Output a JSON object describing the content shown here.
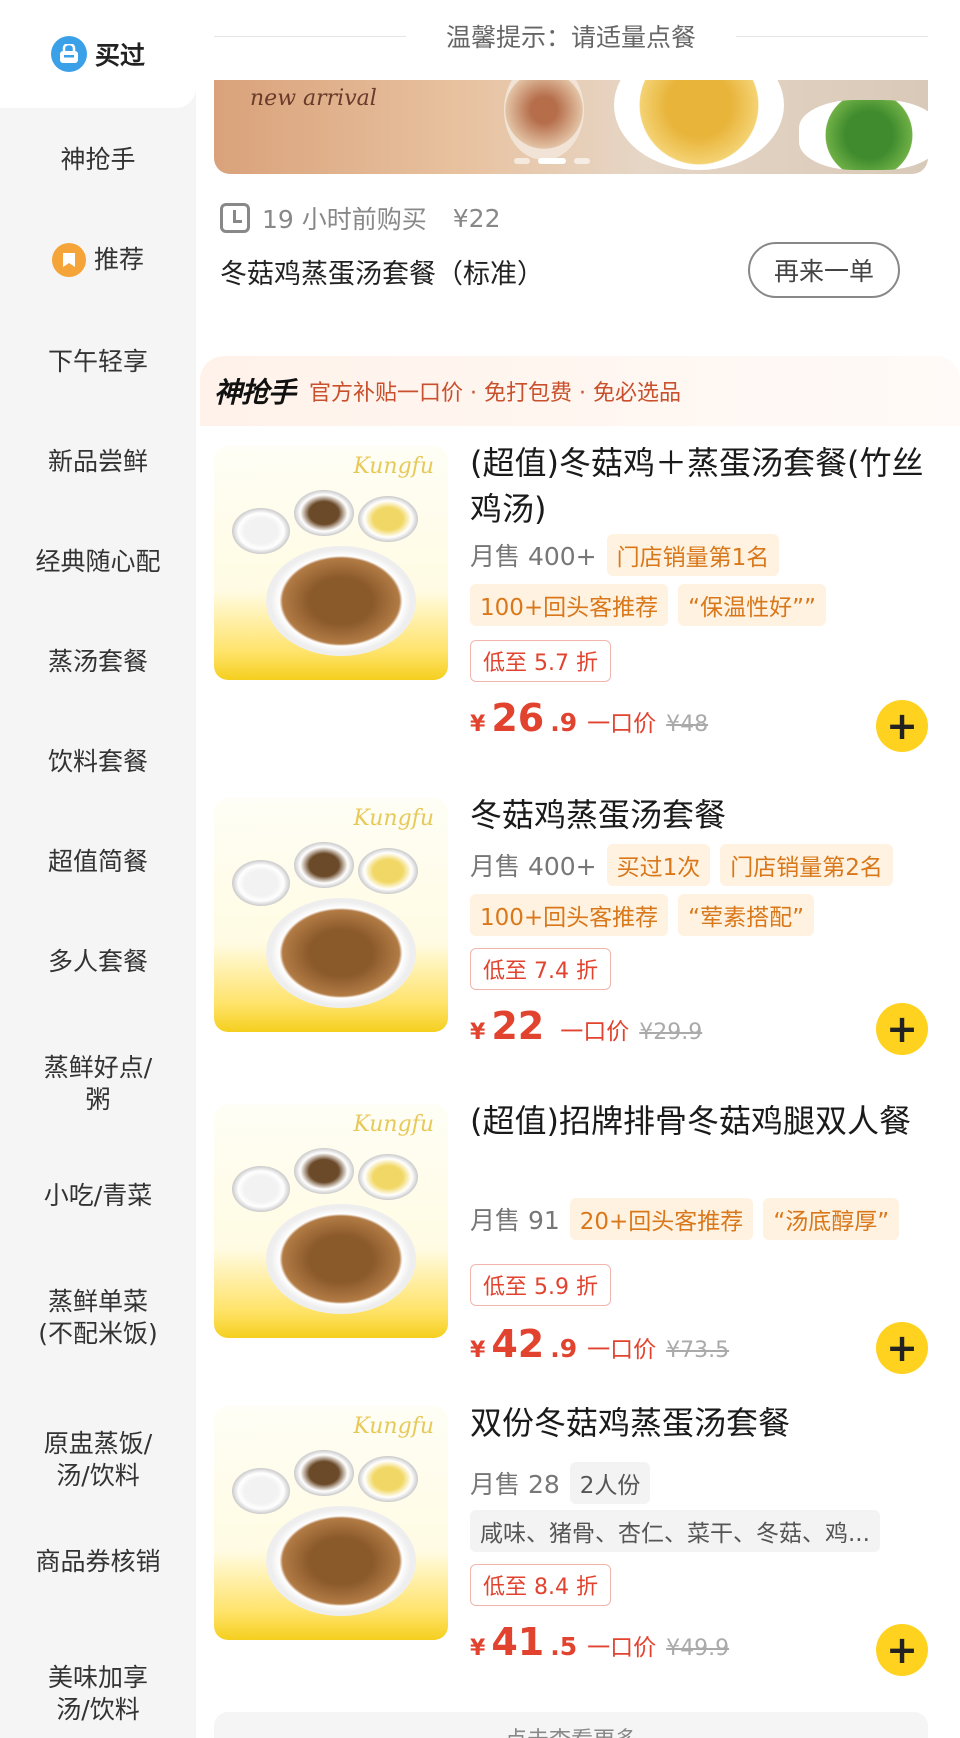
{
  "sidebar": {
    "top_label": "买过",
    "items": [
      {
        "label": "神抢手"
      },
      {
        "label": "推荐"
      },
      {
        "label": "下午轻享"
      },
      {
        "label": "新品尝鲜"
      },
      {
        "label": "经典随心配"
      },
      {
        "label": "蒸汤套餐"
      },
      {
        "label": "饮料套餐"
      },
      {
        "label": "超值简餐"
      },
      {
        "label": "多人套餐"
      },
      {
        "label": "蒸鲜好点/",
        "label2": "粥"
      },
      {
        "label": "小吃/青菜"
      },
      {
        "label": "蒸鲜单菜",
        "label2": "(不配米饭)"
      },
      {
        "label": "原盅蒸饭/",
        "label2": "汤/饮料"
      },
      {
        "label": "商品券核销"
      },
      {
        "label": "美味加享",
        "label2": "汤/饮料"
      }
    ]
  },
  "tip": "温馨提示：请适量点餐",
  "banner": {
    "text": "new arrival",
    "active_dot": 2
  },
  "last_order": {
    "time": "19 小时前购买",
    "price": "¥22",
    "name": "冬菇鸡蒸蛋汤套餐（标准）",
    "reorder_label": "再来一单"
  },
  "promo": {
    "logo": "神抢手",
    "text": "官方补贴一口价 · 免打包费 · 免必选品"
  },
  "products": [
    {
      "title": "(超值)冬菇鸡＋蒸蛋汤套餐(竹丝鸡汤)",
      "sales": "月售 400+",
      "tags_row1": [
        "门店销量第1名"
      ],
      "tags_row2": [
        "100+回头客推荐",
        "“保温性好””"
      ],
      "discount": "低至 5.7 折",
      "price_yen": "¥",
      "price_int": "26",
      "price_dec": ".9",
      "price_label": "一口价",
      "price_old": "¥48"
    },
    {
      "title": "冬菇鸡蒸蛋汤套餐",
      "sales": "月售 400+",
      "tags_row1": [
        "买过1次",
        "门店销量第2名"
      ],
      "tags_row2": [
        "100+回头客推荐",
        "“荤素搭配”"
      ],
      "discount": "低至 7.4 折",
      "price_yen": "¥",
      "price_int": "22",
      "price_dec": "",
      "price_label": "一口价",
      "price_old": "¥29.9"
    },
    {
      "title": "(超值)招牌排骨冬菇鸡腿双人餐",
      "sales": "月售 91",
      "tags_row1": [
        "20+回头客推荐",
        "“汤底醇厚”"
      ],
      "tags_row2": [],
      "discount": "低至 5.9 折",
      "price_yen": "¥",
      "price_int": "42",
      "price_dec": ".9",
      "price_label": "一口价",
      "price_old": "¥73.5"
    },
    {
      "title": "双份冬菇鸡蒸蛋汤套餐",
      "sales": "月售 28",
      "tags_row1": [
        "2人份"
      ],
      "tags_row2": [
        "咸味、猪骨、杏仁、菜干、冬菇、鸡..."
      ],
      "discount": "低至 8.4 折",
      "price_yen": "¥",
      "price_int": "41",
      "price_dec": ".5",
      "price_label": "一口价",
      "price_old": "¥49.9"
    }
  ],
  "thumb_brand": "Kungfu",
  "more_label": "点击查看更多"
}
